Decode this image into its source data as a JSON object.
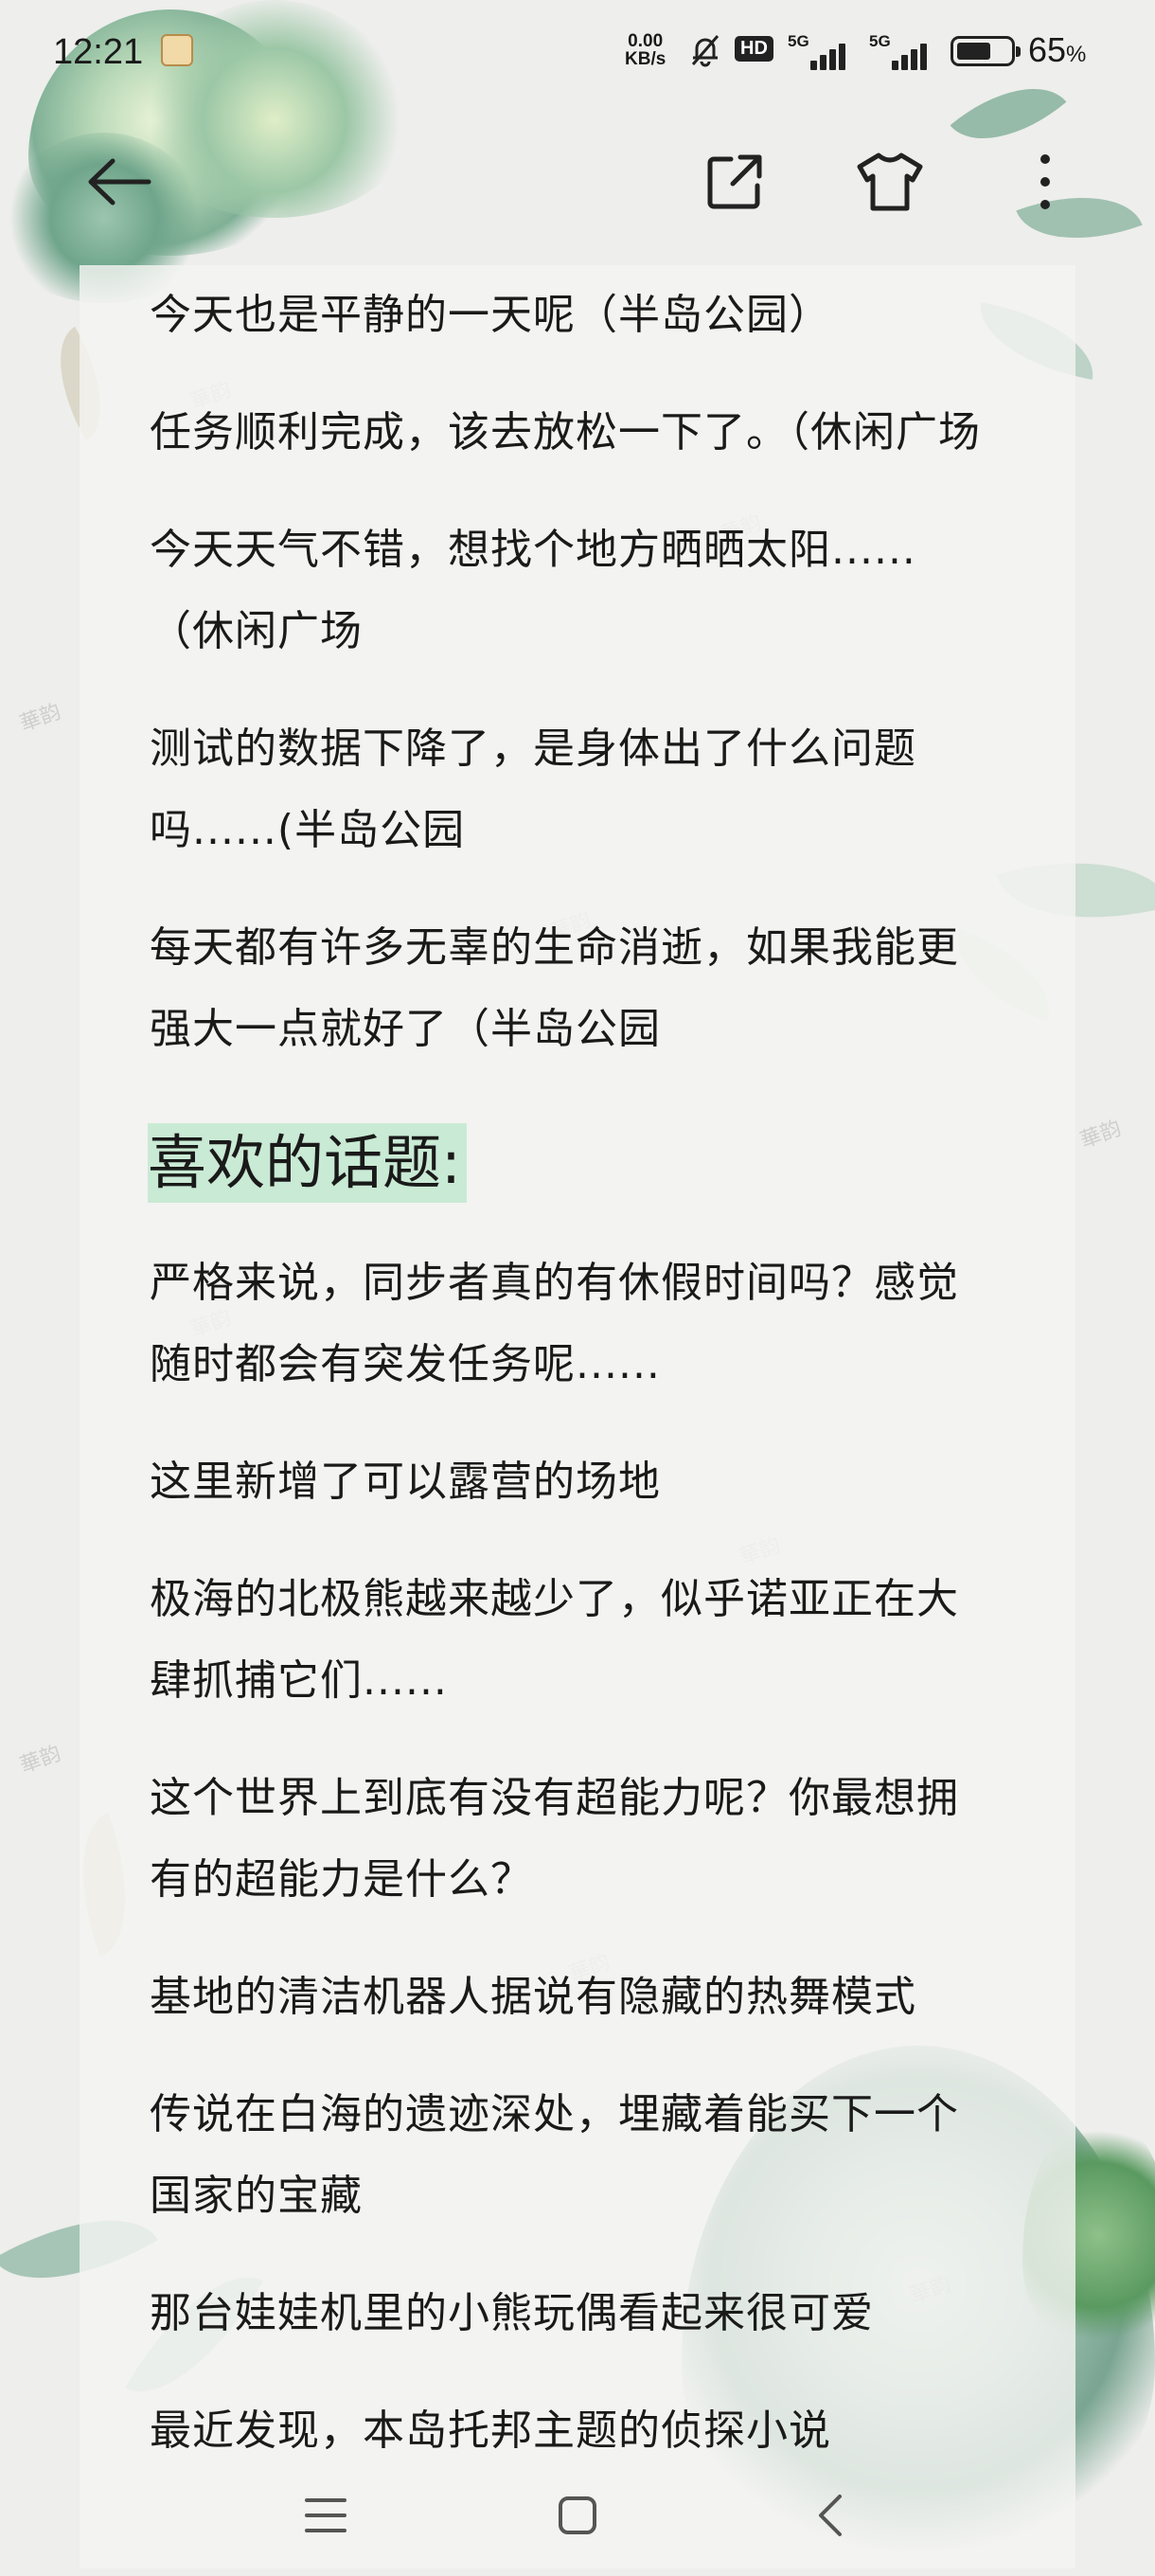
{
  "status_bar": {
    "time": "12:21",
    "net_speed_value": "0.00",
    "net_speed_unit": "KB/s",
    "hd_label": "HD",
    "sim1_label": "5G",
    "sim2_label": "5G",
    "battery_percent": "65",
    "battery_unit": "%",
    "battery_level": 0.65
  },
  "toolbar": {
    "icons": [
      "back-arrow-icon",
      "share-icon",
      "theme-shirt-icon",
      "more-icon"
    ]
  },
  "content": {
    "entries_top": [
      "今天也是平静的一天呢（半岛公园）",
      "任务顺利完成，该去放松一下了。（休闲广场",
      "今天天气不错，想找个地方晒晒太阳......（休闲广场",
      "测试的数据下降了，是身体出了什么问题吗......(半岛公园",
      "每天都有许多无辜的生命消逝，如果我能更强大一点就好了（半岛公园"
    ],
    "section_title": "喜欢的话题:",
    "entries_topics": [
      "严格来说，同步者真的有休假时间吗？感觉随时都会有突发任务呢......",
      "这里新增了可以露营的场地",
      "极海的北极熊越来越少了，似乎诺亚正在大肆抓捕它们......",
      "这个世界上到底有没有超能力呢？你最想拥有的超能力是什么？",
      "基地的清洁机器人据说有隐藏的热舞模式",
      "传说在白海的遗迹深处，埋藏着能买下一个国家的宝藏",
      "那台娃娃机里的小熊玩偶看起来很可爱",
      "最近发现，本岛托邦主题的侦探小说"
    ]
  },
  "watermark_text": "華韵",
  "nav_bar": {
    "icons": [
      "menu-icon",
      "home-square-icon",
      "back-chevron-icon"
    ]
  },
  "colors": {
    "background": "#eeeeec",
    "highlight": "#c9ead4",
    "leaf_green": "#8fb9a0"
  }
}
